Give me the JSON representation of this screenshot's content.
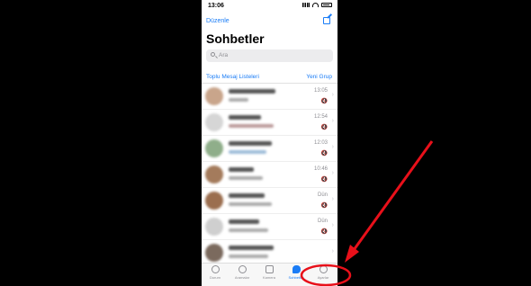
{
  "status_bar": {
    "time": "13:06"
  },
  "header": {
    "edit_label": "Düzenle",
    "title": "Sohbetler"
  },
  "search": {
    "placeholder": "Ara"
  },
  "links": {
    "broadcast": "Toplu Mesaj Listeleri",
    "new_group": "Yeni Grup"
  },
  "chats": [
    {
      "time": "13:05",
      "muted": "🔇"
    },
    {
      "time": "12:54",
      "muted": "🔇"
    },
    {
      "time": "12:03",
      "muted": "🔇"
    },
    {
      "time": "10:46",
      "muted": "🔇"
    },
    {
      "time": "Dün",
      "muted": "🔇"
    },
    {
      "time": "Dün",
      "muted": "🔇"
    }
  ],
  "tabbar": {
    "tabs": [
      {
        "label": "Durum"
      },
      {
        "label": "Aramalar"
      },
      {
        "label": "Kamera"
      },
      {
        "label": "Sohbetler"
      },
      {
        "label": "Ayarlar"
      }
    ]
  },
  "colors": {
    "accent": "#1a7cf6",
    "annotation": "#e8101a",
    "background": "#000000"
  }
}
